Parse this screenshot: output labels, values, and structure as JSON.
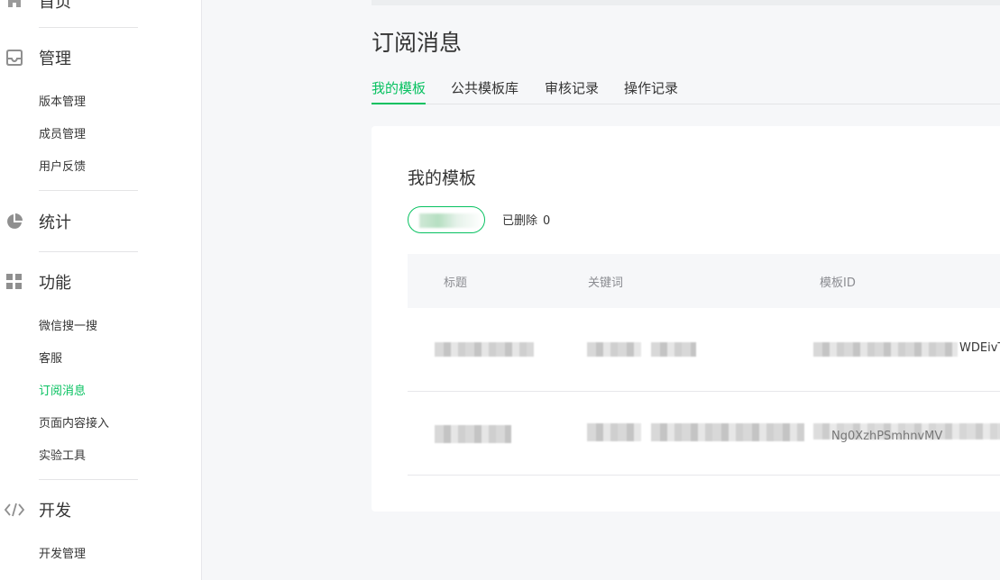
{
  "sidebar": {
    "sections": [
      {
        "label": "首页",
        "icon": "home-icon"
      },
      {
        "label": "管理",
        "icon": "inbox-icon",
        "items": [
          "版本管理",
          "成员管理",
          "用户反馈"
        ]
      },
      {
        "label": "统计",
        "icon": "pie-chart-icon"
      },
      {
        "label": "功能",
        "icon": "grid-icon",
        "items": [
          "微信搜一搜",
          "客服",
          "订阅消息",
          "页面内容接入",
          "实验工具"
        ]
      },
      {
        "label": "开发",
        "icon": "code-icon",
        "items": [
          "开发管理"
        ]
      }
    ],
    "active_item": "订阅消息"
  },
  "page": {
    "title": "订阅消息",
    "tabs": [
      "我的模板",
      "公共模板库",
      "审核记录",
      "操作记录"
    ],
    "active_tab": "我的模板"
  },
  "card": {
    "title": "我的模板",
    "deleted_label": "已删除",
    "deleted_count": "0",
    "table": {
      "headers": [
        "标题",
        "关键词",
        "模板ID"
      ],
      "rows": [
        {
          "template_id_visible": "WDEivT"
        },
        {
          "template_id_visible": "Ng0XzhPSmhnvMV"
        }
      ]
    }
  },
  "colors": {
    "accent": "#07c160",
    "text": "#353535",
    "muted": "#8b8c91",
    "background": "#f6f7f9"
  }
}
